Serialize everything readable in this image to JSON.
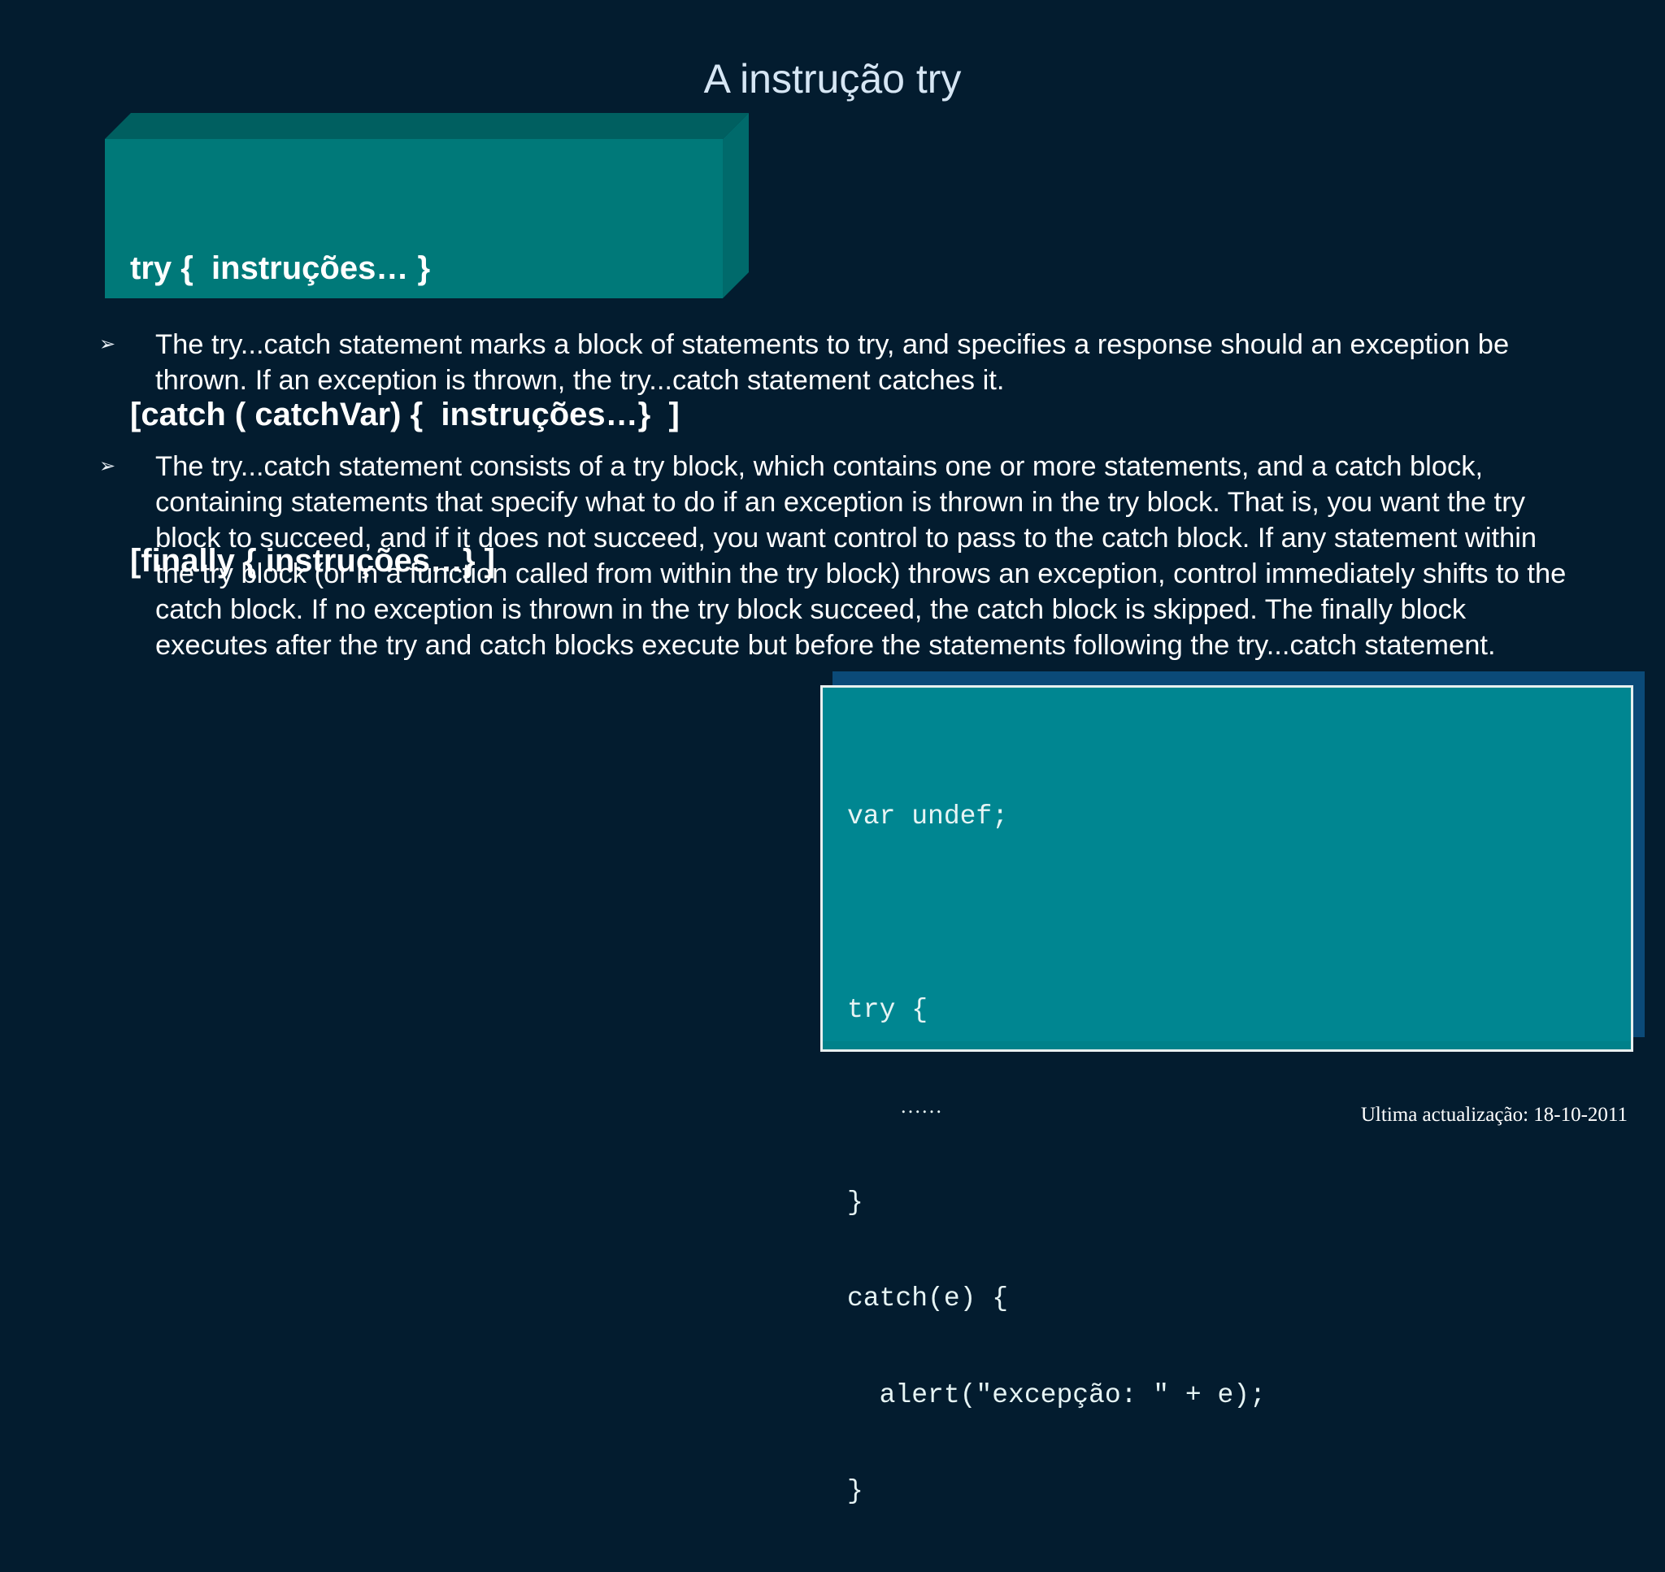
{
  "title": "A instrução try",
  "syntax": {
    "lines": [
      "try {  instruções… }",
      "[catch ( catchVar) {  instruções…}  ]",
      "[finally { instruções…} ]"
    ],
    "colors": {
      "front": "#007979",
      "top": "#005f60",
      "side": "#006a6b"
    }
  },
  "bullets": [
    {
      "marker": "➢",
      "text": "The try...catch statement marks a block of statements to try, and specifies a response should an exception be thrown. If an exception is thrown, the try...catch statement catches it."
    },
    {
      "marker": "➢",
      "text": "The try...catch statement consists of a try block, which contains one or more statements, and a catch block, containing statements that specify what to do if an exception is thrown in the try block. That is, you want the try block to succeed, and if it does not succeed, you want control to pass to the catch block. If any statement within the try block (or in a function called from within the try block) throws an exception, control immediately shifts to the catch block. If no exception is thrown in the try block succeed, the catch block is skipped. The finally block executes after the try and catch blocks execute but before the statements following the try...catch statement."
    }
  ],
  "code": {
    "line1": "var undef;",
    "line2": "try {",
    "line3": "……",
    "line4": "}",
    "line5": "catch(e) {",
    "line6": "  alert(\"excepção: \" + e);",
    "line7": "}"
  },
  "footer": "Ultima actualização: 18-10-2011",
  "colors": {
    "background": "#031c2f",
    "code_box": "#008691",
    "code_shadow": "#0b4a78"
  }
}
